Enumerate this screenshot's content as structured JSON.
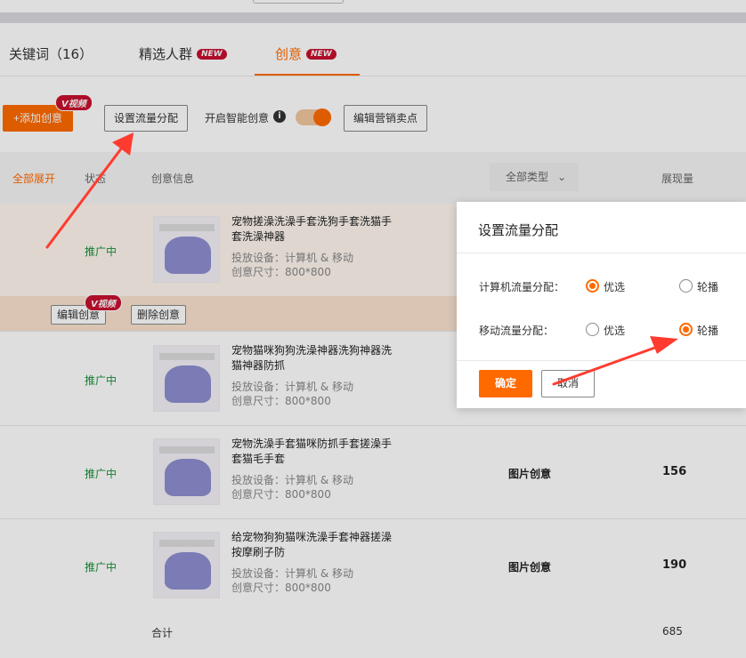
{
  "tabs": [
    {
      "label": "关键词（16）"
    },
    {
      "label": "精选人群",
      "badge": "NEW"
    },
    {
      "label": "创意",
      "badge": "NEW"
    }
  ],
  "toolbar": {
    "add_label": "+添加创意",
    "video_badge": "V视频",
    "traffic_label": "设置流量分配",
    "smart_label": "开启智能创意",
    "edit_selling_label": "编辑营销卖点"
  },
  "table": {
    "expand_all": "全部展开",
    "col_status": "状态",
    "col_info": "创意信息",
    "type_filter": "全部类型",
    "col_views": "展现量",
    "device_prefix": "投放设备：",
    "size_prefix": "创意尺寸：",
    "rows": [
      {
        "status": "推广中",
        "title": "宠物搓澡洗澡手套洗狗手套洗猫手套洗澡神器",
        "device": "计算机 & 移动",
        "size": "800*800",
        "type": "",
        "views": ""
      },
      {
        "status": "推广中",
        "title": "宠物猫咪狗狗洗澡神器洗狗神器洗猫神器防抓",
        "device": "计算机 & 移动",
        "size": "800*800",
        "type": "",
        "views": ""
      },
      {
        "status": "推广中",
        "title": "宠物洗澡手套猫咪防抓手套搓澡手套猫毛手套",
        "device": "计算机 & 移动",
        "size": "800*800",
        "type": "图片创意",
        "views": "156"
      },
      {
        "status": "推广中",
        "title": "给宠物狗狗猫咪洗澡手套神器搓澡按摩刷子防",
        "device": "计算机 & 移动",
        "size": "800*800",
        "type": "图片创意",
        "views": "190"
      }
    ],
    "row_actions": {
      "edit": "编辑创意",
      "delete": "删除创意",
      "video_badge": "V视频"
    },
    "total_label": "合计",
    "total_views": "685"
  },
  "modal": {
    "title": "设置流量分配",
    "pc_label": "计算机流量分配：",
    "mobile_label": "移动流量分配：",
    "opt_preferred": "优选",
    "opt_rotate": "轮播",
    "pc_selected": "优选",
    "mobile_selected": "轮播",
    "ok": "确定",
    "cancel": "取消"
  },
  "colors": {
    "accent": "#ff6a00",
    "badge": "#c8102e",
    "status": "#1a8f3a",
    "annotation": "#ff3b2f"
  }
}
